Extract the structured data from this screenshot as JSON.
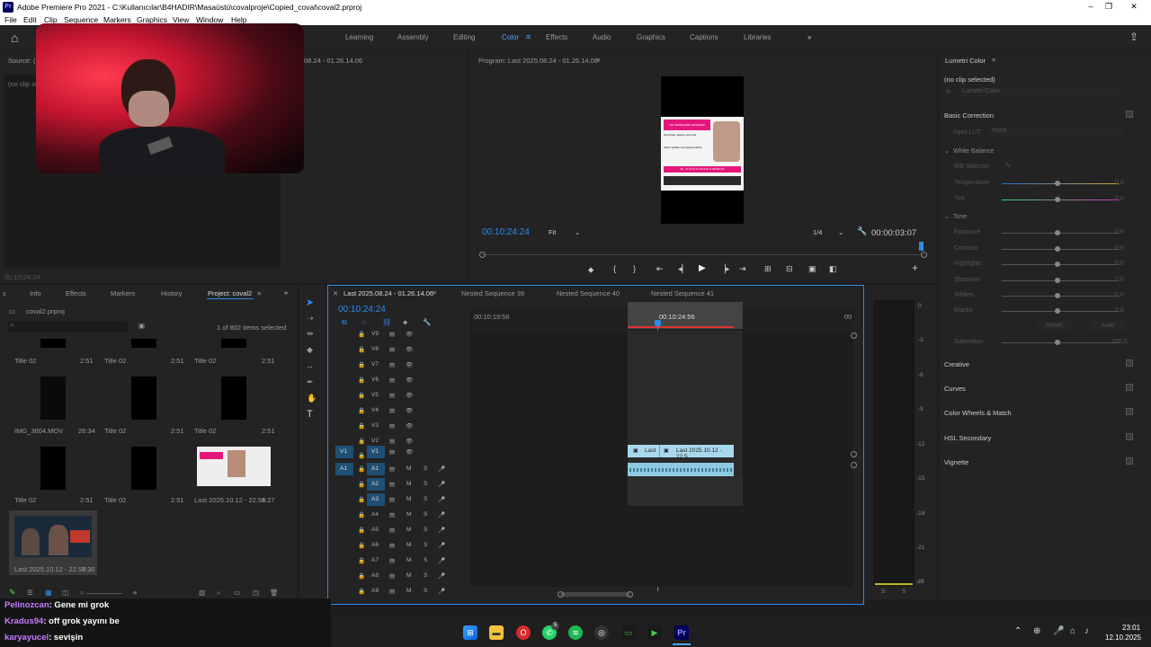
{
  "window": {
    "title": "Adobe Premiere Pro 2021 - C:\\Kullanıcılar\\B4HADIR\\Masaüstü\\covalproje\\Copied_coval\\coval2.prproj",
    "logo": "Pr"
  },
  "menu": [
    "File",
    "Edit",
    "Clip",
    "Sequence",
    "Markers",
    "Graphics",
    "View",
    "Window",
    "Help"
  ],
  "workspaces": [
    "Learning",
    "Assembly",
    "Editing",
    "Color",
    "Effects",
    "Audio",
    "Graphics",
    "Captions",
    "Libraries"
  ],
  "workspace_active": "Color",
  "source": {
    "header": "Source: (n",
    "no_clip": "(no clip selec",
    "timecode": "00:10:24:24",
    "header_tail": "08.24 - 01.26.14.06"
  },
  "program": {
    "header": "Program: Last 2025.08.24 - 01.26.14.06",
    "timecode": "00:10:24:24",
    "fit": "Fit",
    "quality": "1/4",
    "duration": "00:00:03:07"
  },
  "preview": {
    "headline": "TEK BOBİNLERE SEVDİLER",
    "line1": "Rusya'ları sadece yanımda",
    "line2": "Hiçbir şekilde çok paraya kaldım",
    "footer": "36 - 37 EYLÜL KONUK KURUMLAR"
  },
  "lumetri": {
    "header": "Lumetri Color",
    "no_clip": "(no clip selected)",
    "fx_label": "fx",
    "fx_value": "Lumetri Color",
    "basic_correction": "Basic Correction",
    "input_lut_label": "Input LUT",
    "input_lut_value": "None",
    "white_balance": "White Balance",
    "wb_selector": "WB Selector",
    "temperature": {
      "label": "Temperature",
      "value": "0,0"
    },
    "tint": {
      "label": "Tint",
      "value": "0,0"
    },
    "tone": "Tone",
    "tone_params": [
      {
        "label": "Exposure",
        "value": "0,0"
      },
      {
        "label": "Contrast",
        "value": "0,0"
      },
      {
        "label": "Highlights",
        "value": "0,0"
      },
      {
        "label": "Shadows",
        "value": "0,0"
      },
      {
        "label": "Whites",
        "value": "0,0"
      },
      {
        "label": "Blacks",
        "value": "0,0"
      }
    ],
    "reset": "Reset",
    "auto": "Auto",
    "saturation": {
      "label": "Saturation",
      "value": "100,0"
    },
    "sections": [
      "Creative",
      "Curves",
      "Color Wheels & Match",
      "HSL Secondary",
      "Vignette"
    ]
  },
  "project": {
    "tabs": [
      "Info",
      "Effects",
      "Markers",
      "History",
      "Project: coval2"
    ],
    "tab_lead": "s",
    "active_tab": "Project: coval2",
    "file": "coval2.prproj",
    "selected": "1 of 802 items selected",
    "items": [
      {
        "name": "Title 02",
        "dur": "2:51"
      },
      {
        "name": "Title 02",
        "dur": "2:51"
      },
      {
        "name": "Title 02",
        "dur": "2:51"
      },
      {
        "name": "IMG_3604.MOV",
        "dur": "26:34"
      },
      {
        "name": "Title 02",
        "dur": "2:51"
      },
      {
        "name": "Title 02",
        "dur": "2:51"
      },
      {
        "name": "Title 02",
        "dur": "2:51"
      },
      {
        "name": "Title 02",
        "dur": "2:51"
      },
      {
        "name": "Last 2025.10.12 - 22.54...",
        "dur": "5:27"
      },
      {
        "name": "Last 2025.10.12 - 22.57...",
        "dur": "8:30"
      }
    ]
  },
  "timeline": {
    "tabs": [
      "Last 2025.08.24 - 01.26.14.06",
      "Nested Sequence 39",
      "Nested Sequence 40",
      "Nested Sequence 41"
    ],
    "timecode": "00:10:24:24",
    "ruler": [
      "00:10:19:56",
      "00:10:24:56",
      "00"
    ],
    "video_tracks": [
      "V9",
      "V8",
      "V7",
      "V6",
      "V5",
      "V4",
      "V3",
      "V2",
      "V1"
    ],
    "audio_tracks": [
      "A1",
      "A2",
      "A3",
      "A4",
      "A5",
      "A6",
      "A7",
      "A8",
      "A9"
    ],
    "source_patch_v": "V1",
    "source_patch_a": "A1",
    "clip_a_label": "Last",
    "clip_b_label": "Last 2025.10.12 - 22.5",
    "mute": "M",
    "solo": "S"
  },
  "meters": {
    "scale": [
      "0",
      "-3",
      "-6",
      "-9",
      "-12",
      "-15",
      "-18",
      "-21",
      "dB"
    ],
    "solo": [
      "S",
      "S"
    ]
  },
  "chat": [
    {
      "user": "Pelinozcan",
      "msg": ": Gene mi grok",
      "color": "#c77dff"
    },
    {
      "user": "Kradus94",
      "msg": ": off grok yayını be",
      "color": "#c77dff"
    },
    {
      "user": "karyayucel",
      "msg": ": sevişin",
      "color": "#c77dff"
    }
  ],
  "taskbar": {
    "time": "23:01",
    "date": "12.10.2025",
    "whatsapp_badge": "5"
  },
  "icons": {
    "home": "⌂",
    "export": "⇪",
    "play": "▶",
    "add": "+",
    "wrench": "🔧",
    "eye": "👁",
    "lock": "🔒",
    "mic": "🎤",
    "search": "⌕",
    "filter": "⏷",
    "more": "»"
  }
}
